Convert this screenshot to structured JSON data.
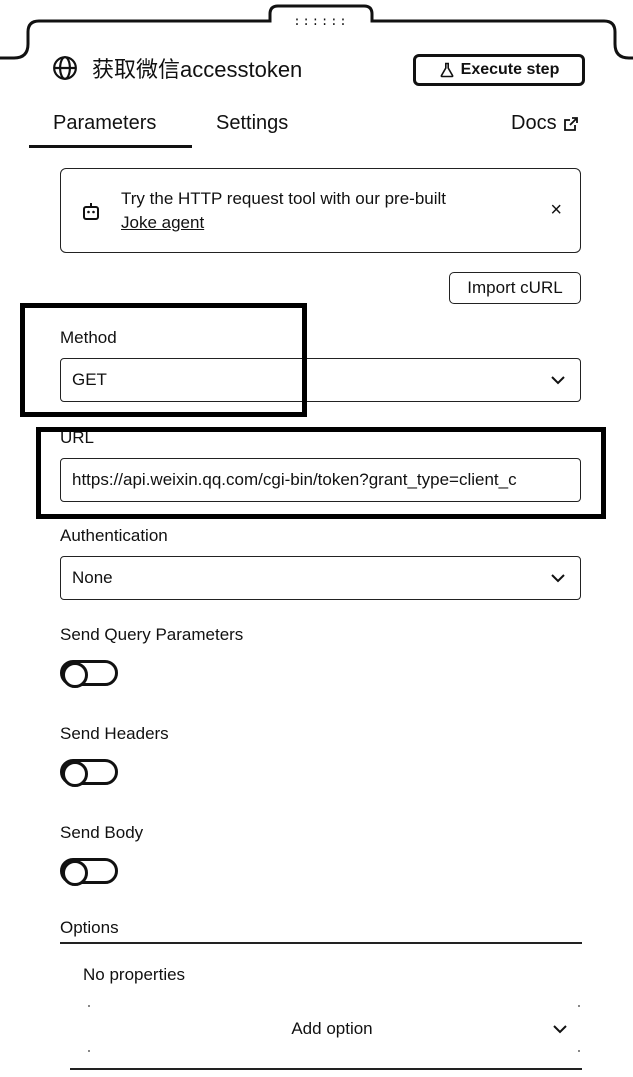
{
  "header": {
    "title": "获取微信accesstoken",
    "execute_label": "Execute step",
    "drag_handle": "::::::"
  },
  "tabs": {
    "parameters": "Parameters",
    "settings": "Settings",
    "docs": "Docs",
    "active": "Parameters"
  },
  "banner": {
    "text": "Try the HTTP request tool with our pre-built",
    "link": "Joke agent",
    "close": "×"
  },
  "import_curl": "Import cURL",
  "method": {
    "label": "Method",
    "value": "GET"
  },
  "url": {
    "label": "URL",
    "value": "https://api.weixin.qq.com/cgi-bin/token?grant_type=client_c"
  },
  "authentication": {
    "label": "Authentication",
    "value": "None"
  },
  "send_query": {
    "label": "Send Query Parameters",
    "enabled": false
  },
  "send_headers": {
    "label": "Send Headers",
    "enabled": false
  },
  "send_body": {
    "label": "Send Body",
    "enabled": false
  },
  "options": {
    "label": "Options",
    "empty_text": "No properties",
    "add_label": "Add option"
  },
  "icons": {
    "title": "globe-icon",
    "execute": "flask-icon",
    "docs": "external-link-icon",
    "banner": "robot-icon",
    "dropdown": "chevron-down-icon"
  }
}
